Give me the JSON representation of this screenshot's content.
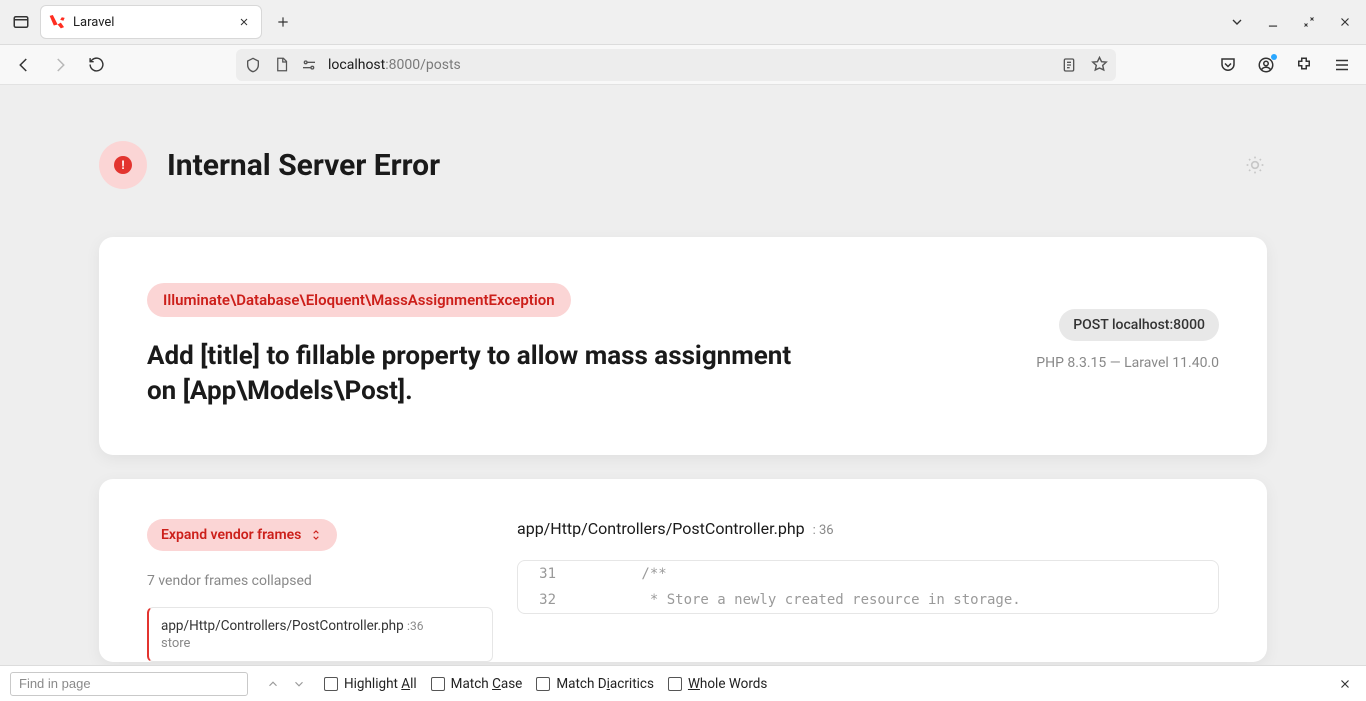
{
  "browser": {
    "tab_title": "Laravel",
    "url_host": "localhost",
    "url_rest": ":8000/posts"
  },
  "findbar": {
    "placeholder": "Find in page",
    "highlight": "Highlight ",
    "highlight_u": "A",
    "highlight_suffix": "ll",
    "matchcase": "Match ",
    "matchcase_u": "C",
    "matchcase_suffix": "ase",
    "diacritics": "Match D",
    "diacritics_u": "i",
    "diacritics_suffix": "acritics",
    "whole": "",
    "whole_u": "W",
    "whole_suffix": "hole Words"
  },
  "error": {
    "title": "Internal Server Error",
    "exception": "Illuminate\\Database\\Eloquent\\MassAssignmentException",
    "message": "Add [title] to fillable property to allow mass assignment on [App\\Models\\Post].",
    "method_host": "POST localhost:8000",
    "versions": "PHP 8.3.15 — Laravel 11.40.0"
  },
  "frames": {
    "expand_label": "Expand vendor frames",
    "collapsed_note": "7 vendor frames collapsed",
    "active": {
      "path": "app/Http/Controllers/PostController.php",
      "line": ":36",
      "fn": "store"
    }
  },
  "code": {
    "file": "app/Http/Controllers/PostController.php",
    "line": ": 36",
    "lines": [
      {
        "n": "31",
        "t": "        /**"
      },
      {
        "n": "32",
        "t": "         * Store a newly created resource in storage."
      }
    ]
  }
}
